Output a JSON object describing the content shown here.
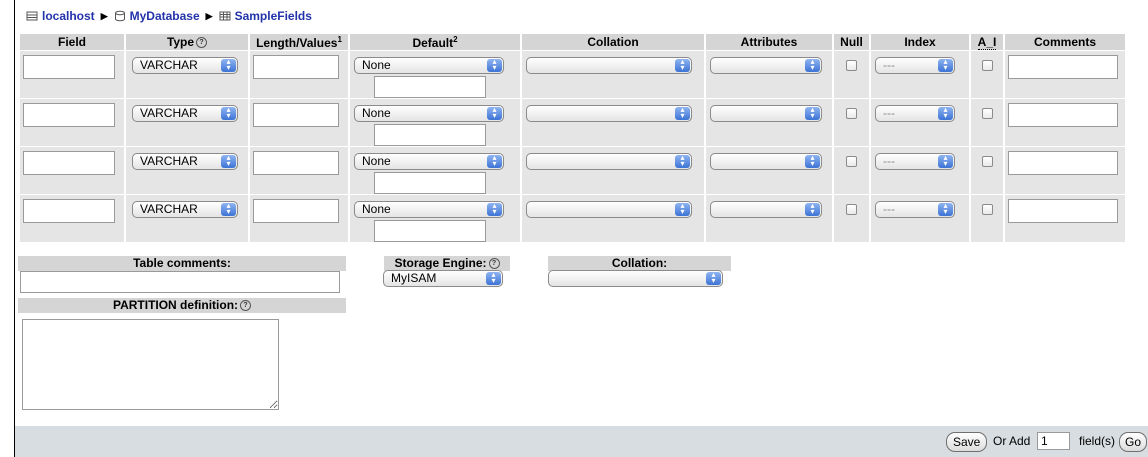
{
  "breadcrumb": {
    "server": "localhost",
    "database": "MyDatabase",
    "table": "SampleFields"
  },
  "columns": {
    "field": "Field",
    "type": "Type",
    "length": "Length/Values",
    "length_sup": "1",
    "default": "Default",
    "default_sup": "2",
    "collation": "Collation",
    "attributes": "Attributes",
    "null": "Null",
    "index": "Index",
    "ai": "A_I",
    "comments": "Comments"
  },
  "rows": [
    {
      "type": "VARCHAR",
      "default": "None",
      "collation": "",
      "attributes": "",
      "index": "---",
      "null_checked": false,
      "ai_checked": false
    },
    {
      "type": "VARCHAR",
      "default": "None",
      "collation": "",
      "attributes": "",
      "index": "---",
      "null_checked": false,
      "ai_checked": false
    },
    {
      "type": "VARCHAR",
      "default": "None",
      "collation": "",
      "attributes": "",
      "index": "---",
      "null_checked": false,
      "ai_checked": false
    },
    {
      "type": "VARCHAR",
      "default": "None",
      "collation": "",
      "attributes": "",
      "index": "---",
      "null_checked": false,
      "ai_checked": false
    }
  ],
  "table_options": {
    "table_comments_label": "Table comments:",
    "storage_engine_label": "Storage Engine:",
    "storage_engine_value": "MyISAM",
    "collation_label": "Collation:",
    "collation_value": "",
    "partition_label": "PARTITION definition:"
  },
  "footer": {
    "save_label": "Save",
    "or_add_label": "Or Add",
    "add_count": "1",
    "fields_label": "field(s)",
    "go_label": "Go"
  }
}
